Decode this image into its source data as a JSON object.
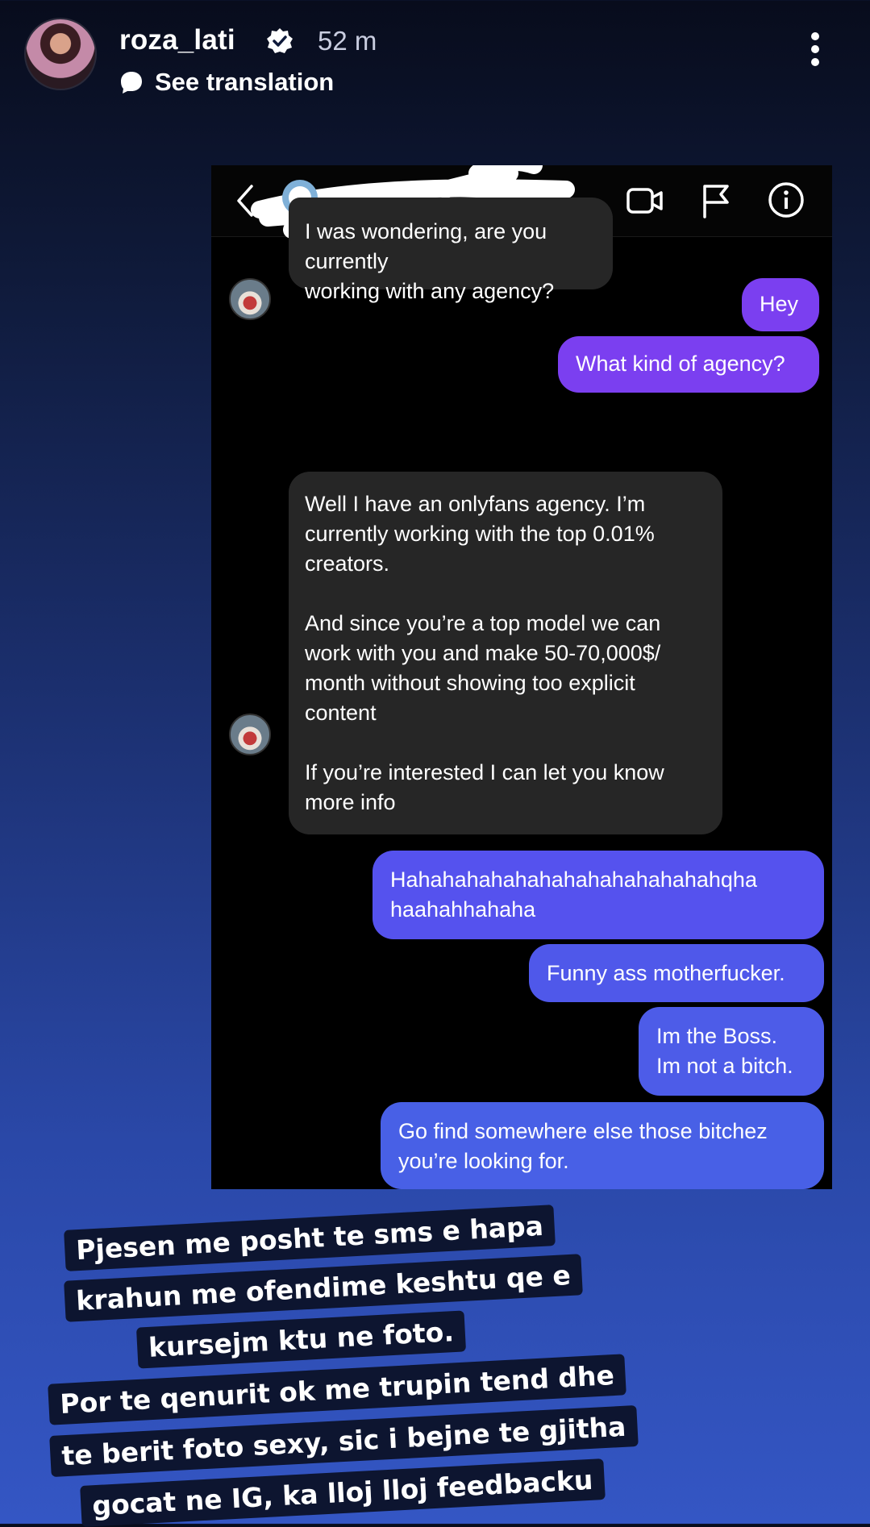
{
  "story": {
    "username": "roza_lati",
    "time": "52 m",
    "translation_label": "See translation"
  },
  "dm": {
    "messages": [
      {
        "side": "in",
        "text": "I was wondering, are you currently\nworking with any agency?"
      },
      {
        "side": "out",
        "text": "Hey"
      },
      {
        "side": "out",
        "text": "What kind of agency?"
      },
      {
        "side": "in",
        "text": "Well I have an onlyfans agency. I’m\ncurrently working with the top 0.01%\ncreators.\n\nAnd since you’re a top model we can\nwork with you and make 50-70,000$/\nmonth without showing too explicit\ncontent\n\nIf you’re interested I can let you know\nmore info"
      },
      {
        "side": "out",
        "text": "Hahahahahahahahahahahahahahqha\nhaahahhahaha"
      },
      {
        "side": "out",
        "text": "Funny ass motherfucker."
      },
      {
        "side": "out",
        "text": "Im the Boss.\nIm not a bitch."
      },
      {
        "side": "out",
        "text": "Go find somewhere else those bitchez\nyou’re looking for."
      }
    ]
  },
  "caption": {
    "lines": [
      "Pjesen me posht te sms e hapa",
      "krahun me ofendime keshtu qe e",
      "kursejm ktu ne foto.",
      "Por te qenurit ok me trupin tend dhe",
      "te berit foto sexy, sic i bejne te gjitha",
      "gocat ne IG, ka lloj lloj feedbacku"
    ]
  },
  "colors": {
    "incoming_bubble": "#262626",
    "outgoing_purple": "#7b3ff0",
    "outgoing_blue": "#4a5be6",
    "caption_bg": "#0d1530"
  },
  "icons": [
    "verified-badge-icon",
    "translate-icon",
    "more-options-icon",
    "back-arrow-icon",
    "video-call-icon",
    "flag-icon",
    "info-icon"
  ]
}
